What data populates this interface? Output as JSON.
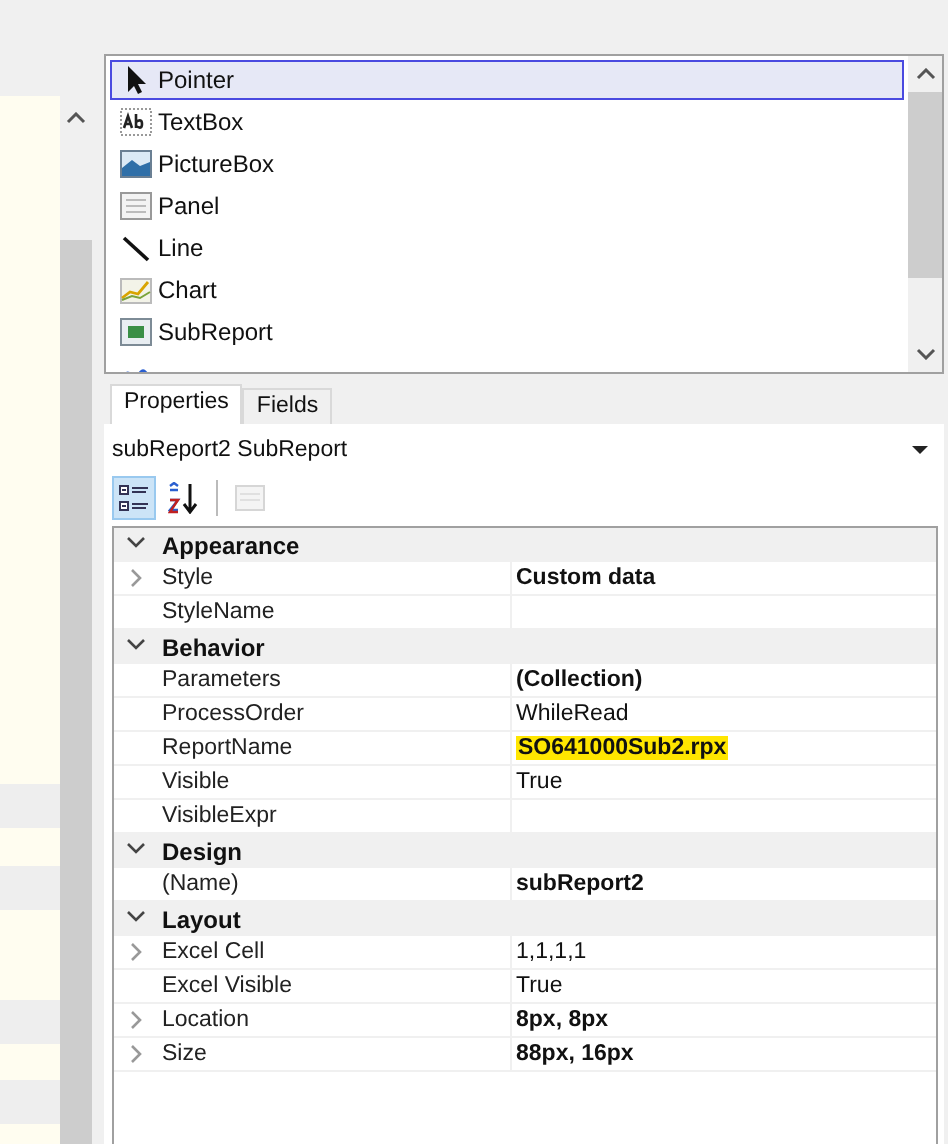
{
  "toolbox": {
    "items": [
      {
        "label": "Pointer",
        "kind": "pointer",
        "selected": true
      },
      {
        "label": "TextBox",
        "kind": "textbox",
        "selected": false
      },
      {
        "label": "PictureBox",
        "kind": "picturebox",
        "selected": false
      },
      {
        "label": "Panel",
        "kind": "panel",
        "selected": false
      },
      {
        "label": "Line",
        "kind": "line",
        "selected": false
      },
      {
        "label": "Chart",
        "kind": "chart",
        "selected": false
      },
      {
        "label": "SubReport",
        "kind": "subreport",
        "selected": false
      },
      {
        "kind": "signature",
        "selected": false
      }
    ]
  },
  "tabs": [
    {
      "label": "Properties",
      "selected": true
    },
    {
      "label": "Fields",
      "selected": false
    }
  ],
  "object_selector": {
    "value": "subReport2 SubReport"
  },
  "toolbar": [
    {
      "kind": "categorized",
      "selected": true,
      "disabled": false
    },
    {
      "kind": "alphabetical",
      "selected": false,
      "disabled": false
    },
    {
      "kind": "pages",
      "selected": false,
      "disabled": true
    }
  ],
  "grid": [
    {
      "category": "Appearance",
      "expanded": true,
      "properties": [
        {
          "name": "Style",
          "value": "Custom data",
          "expandable": true,
          "bold": true,
          "highlighted": false
        },
        {
          "name": "StyleName",
          "expandable": false
        }
      ]
    },
    {
      "category": "Behavior",
      "expanded": true,
      "properties": [
        {
          "name": "Parameters",
          "value": "(Collection)",
          "expandable": false,
          "bold": true,
          "highlighted": false
        },
        {
          "name": "ProcessOrder",
          "value": "WhileRead",
          "expandable": false,
          "bold": false,
          "highlighted": false
        },
        {
          "name": "ReportName",
          "value": "SO641000Sub2.rpx",
          "expandable": false,
          "bold": true,
          "highlighted": true
        },
        {
          "name": "Visible",
          "value": "True",
          "expandable": false,
          "bold": false,
          "highlighted": false
        },
        {
          "name": "VisibleExpr",
          "expandable": false
        }
      ]
    },
    {
      "category": "Design",
      "expanded": true,
      "properties": [
        {
          "name": "(Name)",
          "value": "subReport2",
          "expandable": false,
          "bold": true,
          "highlighted": false
        }
      ]
    },
    {
      "category": "Layout",
      "expanded": true,
      "properties": [
        {
          "name": "Excel Cell",
          "value": "1,1,1,1",
          "expandable": true,
          "bold": false,
          "highlighted": false
        },
        {
          "name": "Excel Visible",
          "value": "True",
          "expandable": false,
          "bold": false,
          "highlighted": false
        },
        {
          "name": "Location",
          "value": "8px, 8px",
          "expandable": true,
          "bold": true,
          "highlighted": false
        },
        {
          "name": "Size",
          "value": "88px, 16px",
          "expandable": true,
          "bold": true,
          "highlighted": false
        }
      ]
    }
  ]
}
